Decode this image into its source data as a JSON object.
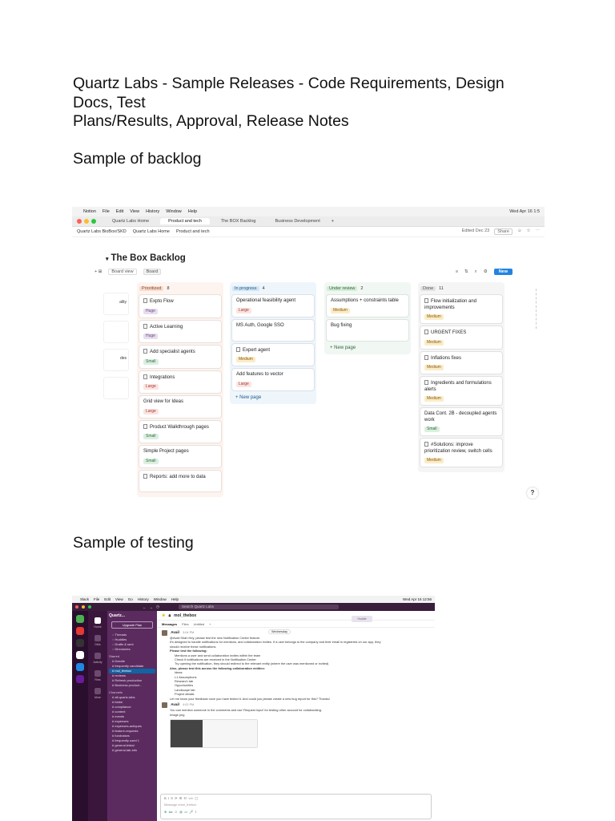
{
  "doc": {
    "title_lines": [
      "Quartz Labs - Sample Releases - Code Requirements, Design",
      "Docs, Test",
      "Plans/Results, Approval, Release Notes"
    ],
    "section_backlog": "Sample of backlog",
    "section_testing": "Sample of testing"
  },
  "backlog": {
    "menubar": [
      "Notion",
      "File",
      "Edit",
      "View",
      "History",
      "Window",
      "Help"
    ],
    "menubar_right": "Wed Apr 16 1:5",
    "tabs": [
      "Quartz Labs Home",
      "Product and tech",
      "The BOX Backlog",
      "Business Development"
    ],
    "bookmarks": [
      "Quartz Labs BioBox/SKD",
      "Quartz Labs Home",
      "Product and tech"
    ],
    "edited": "Edited Dec 23",
    "share": "Share",
    "title": "The Box Backlog",
    "views": [
      "Board view",
      "Board"
    ],
    "new_button": "New",
    "columns": [
      {
        "name": "Prioritized",
        "count": "8",
        "tint": "#fdf4ef",
        "chip_bg": "#f8ddd0",
        "chip_fg": "#8a4a2a",
        "cards": [
          {
            "title": "Expto Flow",
            "tag": "Huge",
            "doc": true
          },
          {
            "title": "Active Learning",
            "tag": "Huge",
            "doc": true
          },
          {
            "title": "Add specialist agents",
            "tag": "Small",
            "doc": true
          },
          {
            "title": "Integrations",
            "tag": "Large",
            "doc": true
          },
          {
            "title": "Grid view for Ideas",
            "tag": "Large",
            "doc": false
          },
          {
            "title": "Product Walkthrough pages",
            "tag": "Small",
            "doc": true
          },
          {
            "title": "Simple Project pages",
            "tag": "Small",
            "doc": false
          },
          {
            "title": "Reports: add more to data",
            "tag": "",
            "doc": true
          }
        ]
      },
      {
        "name": "In progress",
        "count": "4",
        "tint": "#eef5fb",
        "chip_bg": "#d3e5f5",
        "chip_fg": "#1f5b8a",
        "cards": [
          {
            "title": "Operational feasibility agent",
            "tag": "Large",
            "doc": false
          },
          {
            "title": "MS Auth, Google SSO",
            "tag": "",
            "doc": false
          },
          {
            "title": "Expert agent",
            "tag": "Medium",
            "doc": true
          },
          {
            "title": "Add features to vector",
            "tag": "Large",
            "doc": false
          }
        ],
        "new_page": "New page"
      },
      {
        "name": "Under review",
        "count": "2",
        "tint": "#f1f7f2",
        "chip_bg": "#d6ecd9",
        "chip_fg": "#2f6b3c",
        "cards": [
          {
            "title": "Assumptions + constraints table",
            "tag": "Medium",
            "doc": false
          },
          {
            "title": "Bug fixing",
            "tag": "",
            "doc": false
          }
        ],
        "new_page": "New page"
      },
      {
        "name": "Done",
        "count": "11",
        "tint": "#f5f5f5",
        "chip_bg": "#e2e2e2",
        "chip_fg": "#555",
        "cards": [
          {
            "title": "Flow initialization and improvements",
            "tag": "Medium",
            "doc": true
          },
          {
            "title": "URGENT FIXES",
            "tag": "Medium",
            "doc": true
          },
          {
            "title": "Inflations fixes",
            "tag": "Medium",
            "doc": true
          },
          {
            "title": "Ingredients and formulations alerts",
            "tag": "Medium",
            "doc": true
          },
          {
            "title": "Data Cont. 2B - decoupled agents work",
            "tag": "Small",
            "doc": false
          },
          {
            "title": "#Solutions: improve prioritization review, switch cells",
            "tag": "Medium",
            "doc": true
          }
        ]
      }
    ],
    "left_cards": [
      "ality",
      "",
      "des",
      ""
    ]
  },
  "testing": {
    "menubar": [
      "Slack",
      "File",
      "Edit",
      "View",
      "Go",
      "History",
      "Window",
      "Help"
    ],
    "menubar_right": "Wed Apr 16 12:56",
    "search": "Search Quartz Labs",
    "workspace": "Quartz...",
    "upgrade": "Upgrade Plan",
    "sidebar_top": [
      "Threads",
      "Huddles",
      "Drafts & sent",
      "Directories"
    ],
    "starred_title": "Starred",
    "starred": [
      "Deedle",
      "frequently candidate",
      "mol_thebox",
      "reviews",
      "Refresh production",
      "Business product..."
    ],
    "channels_title": "Channels",
    "channels": [
      "all-quartz-labs",
      "biobe",
      "compliance",
      "content",
      "events",
      "expenses",
      "expenses-antiques",
      "feature-requests",
      "fundraises",
      "frequently used 1",
      "general-tristal",
      "general-lab-info"
    ],
    "channel": "mol_thebox",
    "subtabs": [
      "Messages",
      "Files",
      "Untitled"
    ],
    "date_chip": "Wednesday",
    "author": "Avail",
    "time": "3:04 PM",
    "lines": [
      "@Avail Shah Hey, please test the new Notification Center feature.",
      "It's designed to handle notifications for mentions, and collaboration invites. If a user belongs to the company and their email is registered on our app, they",
      "should receive these notifications.",
      "Please test the following:",
      "Mentions a user and send collaboration invites within the team",
      "Check if notifications are received in the Notification Center",
      "Try opening the notification, they should redirect to the relevant entity (where the user was mentioned or invited)",
      "Also, please test this across the following collaboration entities:",
      "Ideas",
      "L1 Assumptions",
      "Research tab",
      "Opportunities",
      "Landscape tab",
      "Project details",
      "Let me know your feedback once you have tested it. And could you please create a new bug report for this? Thanks!"
    ],
    "author2": "Avail",
    "time2": "4:02 PM",
    "lines2": [
      "You can mention someone in the comments and use 'Request Input' for testing other account for collaborating.",
      "Image.png"
    ],
    "compose_placeholder": "Message #mol_thebox",
    "huddle": "Huddle"
  },
  "colors": {
    "slack_sidebar": "#5b2b5f",
    "slack_active": "#1164a3",
    "notion_new": "#2383e2"
  }
}
